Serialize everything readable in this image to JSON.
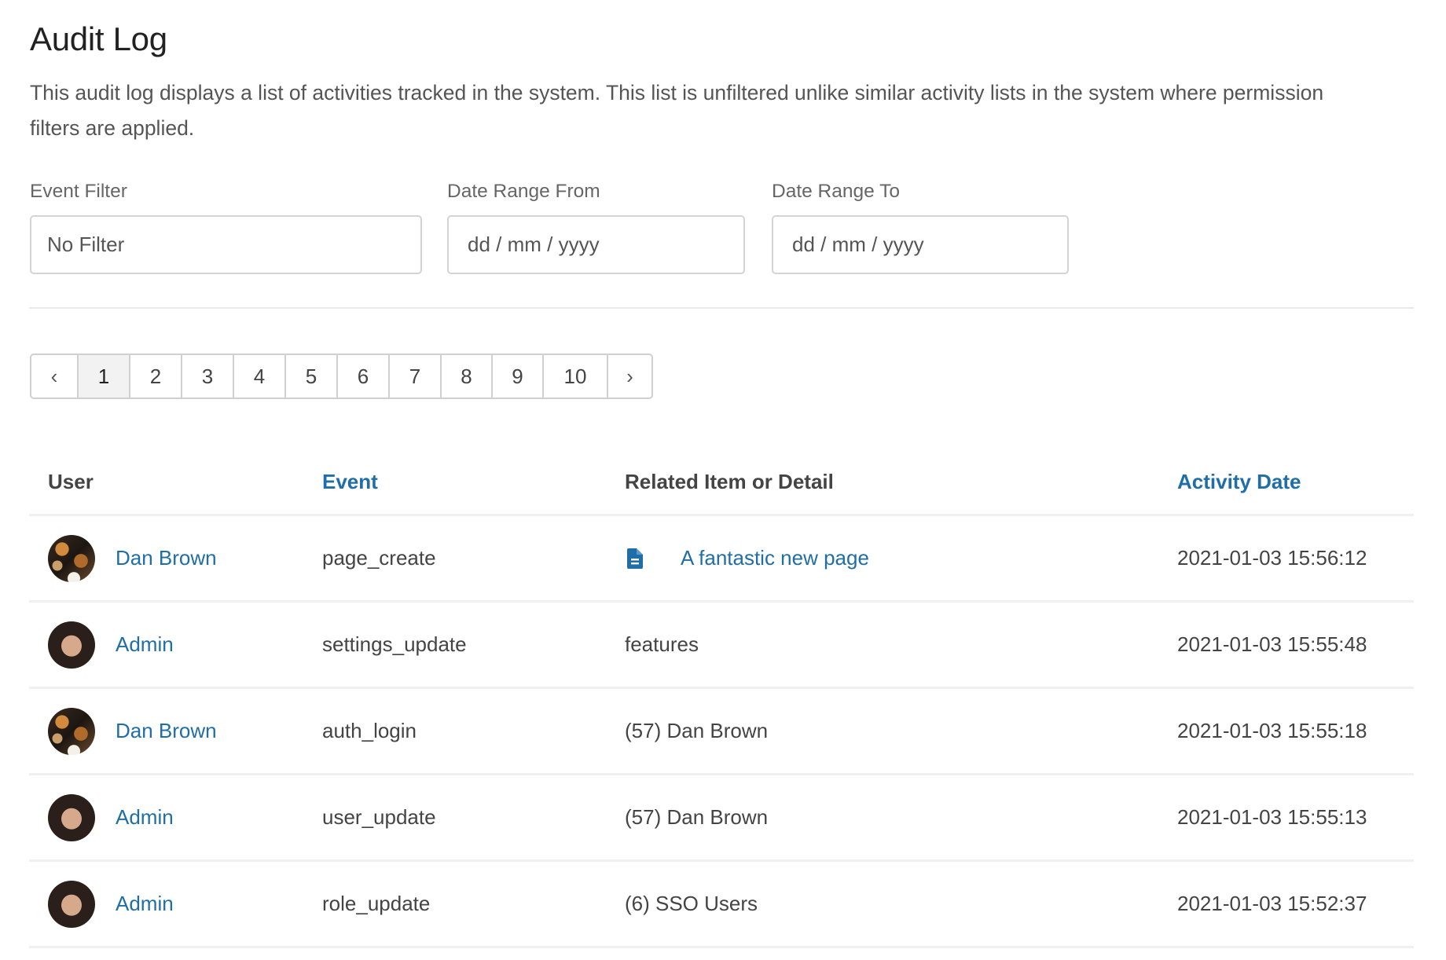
{
  "page": {
    "title": "Audit Log",
    "description": "This audit log displays a list of activities tracked in the system. This list is unfiltered unlike similar activity lists in the system where permission filters are applied."
  },
  "filters": {
    "event_filter": {
      "label": "Event Filter",
      "value": "No Filter"
    },
    "date_from": {
      "label": "Date Range From",
      "placeholder": "dd / mm / yyyy"
    },
    "date_to": {
      "label": "Date Range To",
      "placeholder": "dd / mm / yyyy"
    }
  },
  "pagination": {
    "prev_label": "‹",
    "next_label": "›",
    "pages": [
      "1",
      "2",
      "3",
      "4",
      "5",
      "6",
      "7",
      "8",
      "9",
      "10"
    ],
    "current_page": "1"
  },
  "table": {
    "headers": {
      "user": "User",
      "event": "Event",
      "related": "Related Item or Detail",
      "date": "Activity Date"
    },
    "sortable_columns": [
      "event",
      "date"
    ],
    "rows": [
      {
        "user": "Dan Brown",
        "avatar": "cat-photo",
        "event": "page_create",
        "related": "A fantastic new page",
        "related_is_link": true,
        "related_icon": "page-icon",
        "date": "2021-01-03 15:56:12"
      },
      {
        "user": "Admin",
        "avatar": "woman-photo",
        "event": "settings_update",
        "related": "features",
        "related_is_link": false,
        "date": "2021-01-03 15:55:48"
      },
      {
        "user": "Dan Brown",
        "avatar": "cat-photo",
        "event": "auth_login",
        "related": "(57) Dan Brown",
        "related_is_link": false,
        "date": "2021-01-03 15:55:18"
      },
      {
        "user": "Admin",
        "avatar": "woman-photo",
        "event": "user_update",
        "related": "(57) Dan Brown",
        "related_is_link": false,
        "date": "2021-01-03 15:55:13"
      },
      {
        "user": "Admin",
        "avatar": "woman-photo",
        "event": "role_update",
        "related": "(6) SSO Users",
        "related_is_link": false,
        "date": "2021-01-03 15:52:37"
      }
    ]
  },
  "colors": {
    "link": "#206ea7",
    "text": "#444444",
    "title": "#222222",
    "border": "#d0d0d0",
    "active_page_bg": "#f2f2f2"
  }
}
